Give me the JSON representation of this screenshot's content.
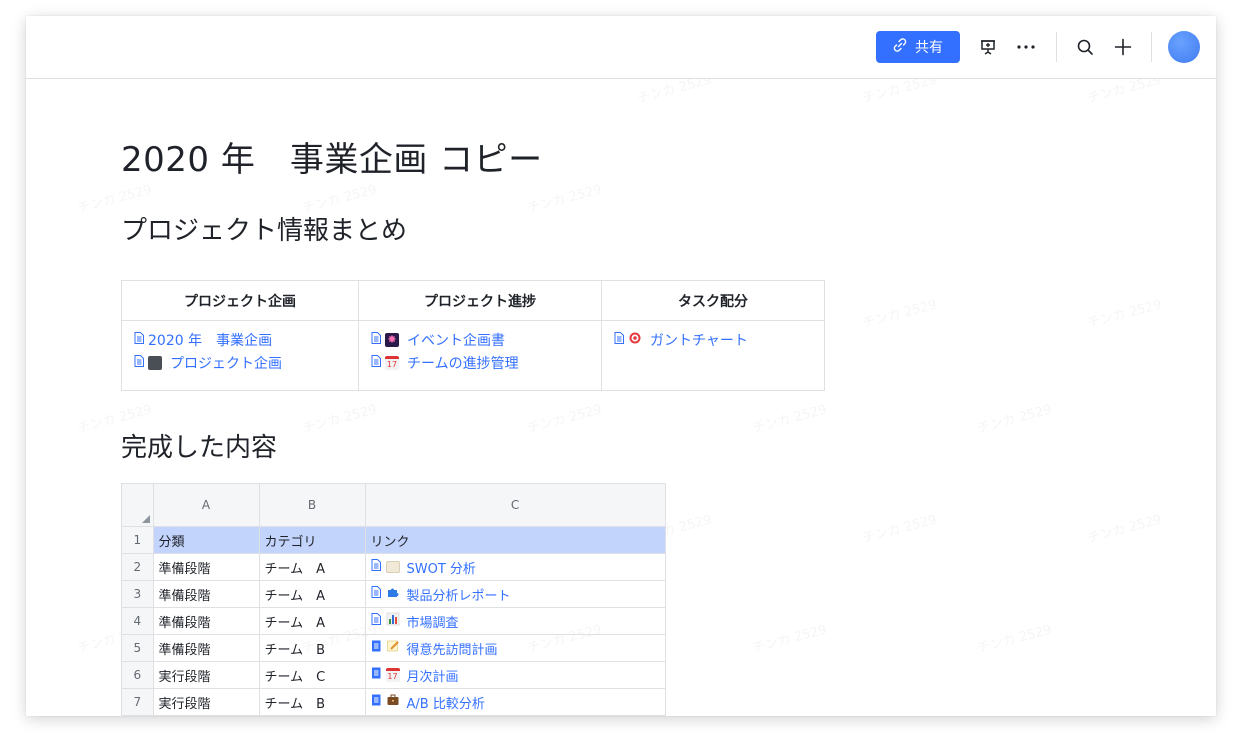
{
  "toolbar": {
    "share_label": "共有",
    "icons": [
      "link-icon",
      "presentation-icon",
      "more-icon",
      "search-icon",
      "plus-icon",
      "avatar"
    ]
  },
  "watermark_text": "チンカ 2529",
  "doc": {
    "title": "2020 年　事業企画 コピー",
    "section1": "プロジェクト情報まとめ",
    "section2": "完成した内容"
  },
  "info_table": {
    "headers": [
      "プロジェクト企画",
      "プロジェクト進捗",
      "タスク配分"
    ],
    "col1": [
      {
        "label": "2020 年　事業企画",
        "icon": "doc-icon"
      },
      {
        "label": "プロジェクト企画",
        "icon": "cabinet-icon"
      }
    ],
    "col2": [
      {
        "label": "イベント企画書",
        "icon": "fireworks-icon"
      },
      {
        "label": "チームの進捗管理",
        "icon": "calendar-icon"
      }
    ],
    "col3": [
      {
        "label": "ガントチャート",
        "icon": "target-icon"
      }
    ]
  },
  "sheet": {
    "columns": [
      "A",
      "B",
      "C"
    ],
    "header_row": {
      "num": "1",
      "a": "分類",
      "b": "カテゴリ",
      "c": "リンク"
    },
    "rows": [
      {
        "num": "2",
        "a": "準備段階",
        "b": "チーム　A",
        "c": "SWOT 分析",
        "icon": "scroll-icon"
      },
      {
        "num": "3",
        "a": "準備段階",
        "b": "チーム　A",
        "c": "製品分析レポート",
        "icon": "puzzle-icon"
      },
      {
        "num": "4",
        "a": "準備段階",
        "b": "チーム　A",
        "c": "市場調査",
        "icon": "bar-chart-icon"
      },
      {
        "num": "5",
        "a": "準備段階",
        "b": "チーム　B",
        "c": "得意先訪問計画",
        "icon": "memo-icon"
      },
      {
        "num": "6",
        "a": "実行段階",
        "b": "チーム　C",
        "c": "月次計画",
        "icon": "calendar-icon"
      },
      {
        "num": "7",
        "a": "実行段階",
        "b": "チーム　B",
        "c": "A/B 比較分析",
        "icon": "briefcase-icon"
      }
    ]
  },
  "colors": {
    "accent": "#3370ff",
    "header_row": "#c2d3fc",
    "border": "#dee0e3"
  }
}
